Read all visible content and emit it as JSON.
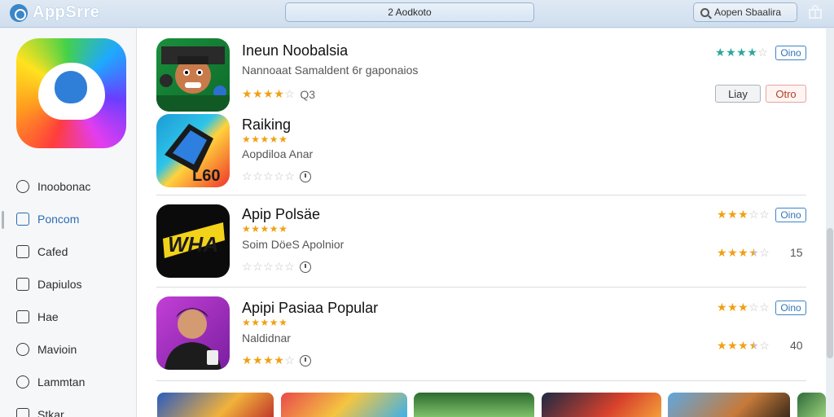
{
  "app": {
    "title": "AppSrre"
  },
  "header": {
    "tab_label": "2 Aodkoto",
    "search_placeholder": "Aopen Sbaalira"
  },
  "sidebar": {
    "items": [
      {
        "label": "Inoobonac",
        "icon": "target-icon",
        "active": false
      },
      {
        "label": "Poncom",
        "icon": "grid-icon",
        "active": true
      },
      {
        "label": "Cafed",
        "icon": "square-icon",
        "active": false
      },
      {
        "label": "Dapiulos",
        "icon": "list-icon",
        "active": false
      },
      {
        "label": "Hae",
        "icon": "arrow-icon",
        "active": false
      },
      {
        "label": "Mavioin",
        "icon": "chat-icon",
        "active": false
      },
      {
        "label": "Lammtan",
        "icon": "gear-icon",
        "active": false
      },
      {
        "label": "Stkar",
        "icon": "bag-icon",
        "active": false
      }
    ]
  },
  "apps": [
    {
      "title": "Ineun Noobalsia",
      "subtitle": "Nannoaat Samaldent 6r gaponaios",
      "rating_label": "Q3",
      "stars": 4,
      "right_stars": 4,
      "right_star_color": "#2aa79b",
      "get_label": "Oino",
      "buttons": {
        "left": "Liay",
        "right": "Otro"
      }
    },
    {
      "title": "Raiking",
      "stars": 5,
      "subtitle": "Aopdiloa Anar",
      "rating_stars": 0
    },
    {
      "title": "Apip Polsäe",
      "stars": 5,
      "subtitle": "Soim DöeS Apolnior",
      "rating_stars": 0,
      "right_stars": 3,
      "get_label": "Oino",
      "right_rating_stars": 3.5,
      "count": "15"
    },
    {
      "title": "Apipi Pasiaa Popular",
      "stars": 5,
      "subtitle": "Naldidnar",
      "rating_stars": 4,
      "right_stars": 3,
      "get_label": "Oino",
      "right_rating_stars": 3.5,
      "count": "40"
    }
  ],
  "colors": {
    "star": "#f0a012",
    "accent": "#3d84c9",
    "topbar": "#d6e3f0"
  }
}
